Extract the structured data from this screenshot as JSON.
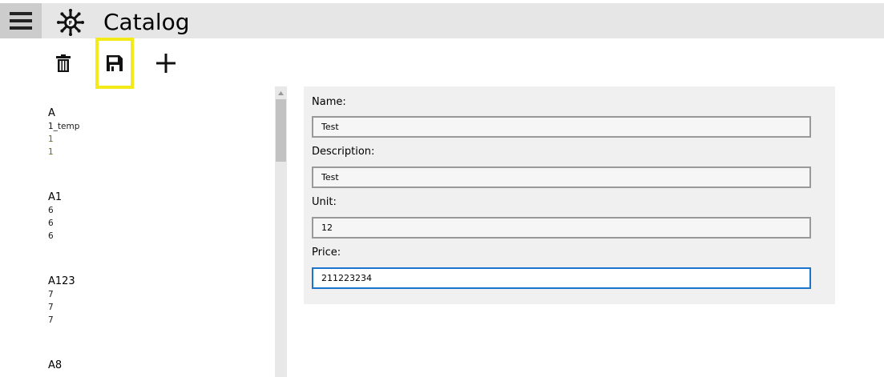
{
  "app": {
    "title": "Catalog"
  },
  "toolbar": {
    "buttons": [
      {
        "icon": "trash-icon",
        "action": "delete"
      },
      {
        "icon": "save-icon",
        "action": "save",
        "highlighted": true
      },
      {
        "icon": "plus-icon",
        "action": "add"
      }
    ]
  },
  "list": {
    "items": [
      {
        "title": "A",
        "lines": [
          "1_temp",
          "1",
          "1"
        ]
      },
      {
        "title": "A1",
        "lines": [
          "6",
          "6",
          "6"
        ]
      },
      {
        "title": "A123",
        "lines": [
          "7",
          "7",
          "7"
        ]
      },
      {
        "title": "A8",
        "lines": []
      }
    ]
  },
  "form": {
    "name_label": "Name:",
    "name_value": "Test",
    "description_label": "Description:",
    "description_value": "Test",
    "unit_label": "Unit:",
    "unit_value": "12",
    "price_label": "Price:",
    "price_value": "211223234"
  },
  "colors": {
    "highlight": "#f2ea19",
    "focus_border": "#1b75cf",
    "title_bar": "#e6e6e6",
    "panel": "#f0f0f0",
    "green_text": "#4b7a14"
  }
}
